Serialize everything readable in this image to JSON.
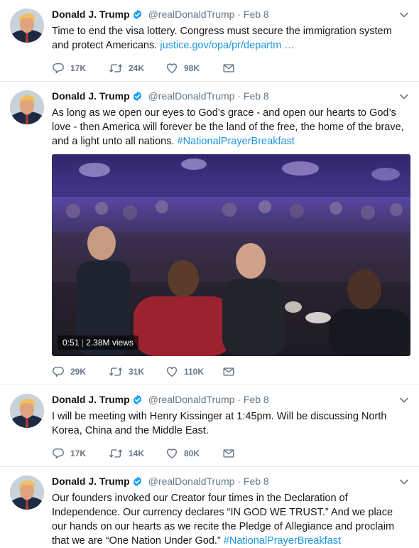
{
  "tweets": [
    {
      "name": "Donald J. Trump",
      "handle": "@realDonaldTrump",
      "separator": "·",
      "date": "Feb 8",
      "text": "Time to end the visa lottery. Congress must secure the immigration system and protect Americans.",
      "link": "justice.gov/opa/pr/departm …",
      "replies": "17K",
      "retweets": "24K",
      "likes": "98K"
    },
    {
      "name": "Donald J. Trump",
      "handle": "@realDonaldTrump",
      "separator": "·",
      "date": "Feb 8",
      "text": "As long as we open our eyes to God’s grace - and open our hearts to God’s love - then America will forever be the land of the free, the home of the brave, and a light unto all nations.",
      "hashtag": "#NationalPrayerBreakfast",
      "video": {
        "duration": "0:51",
        "views": "2.38M views"
      },
      "replies": "29K",
      "retweets": "31K",
      "likes": "110K"
    },
    {
      "name": "Donald J. Trump",
      "handle": "@realDonaldTrump",
      "separator": "·",
      "date": "Feb 8",
      "text": "I will be meeting with Henry Kissinger at 1:45pm. Will be discussing North Korea, China and the Middle East.",
      "replies": "17K",
      "retweets": "14K",
      "likes": "80K"
    },
    {
      "name": "Donald J. Trump",
      "handle": "@realDonaldTrump",
      "separator": "·",
      "date": "Feb 8",
      "text": "Our founders invoked our Creator four times in the Declaration of Independence. Our currency declares “IN GOD WE TRUST.” And we place our hands on our hearts as we recite the Pledge of Allegiance and proclaim that we are “One Nation Under God.”",
      "hashtag": "#NationalPrayerBreakfast"
    }
  ],
  "icons": {
    "avatar": "profile-photo",
    "verified": "verified-badge-icon",
    "caret": "chevron-down-icon",
    "reply": "reply-icon",
    "retweet": "retweet-icon",
    "like": "heart-icon",
    "dm": "envelope-icon"
  },
  "colors": {
    "link": "#1b95e0",
    "verified": "#1da1f2",
    "muted": "#657786",
    "text": "#14171a"
  }
}
